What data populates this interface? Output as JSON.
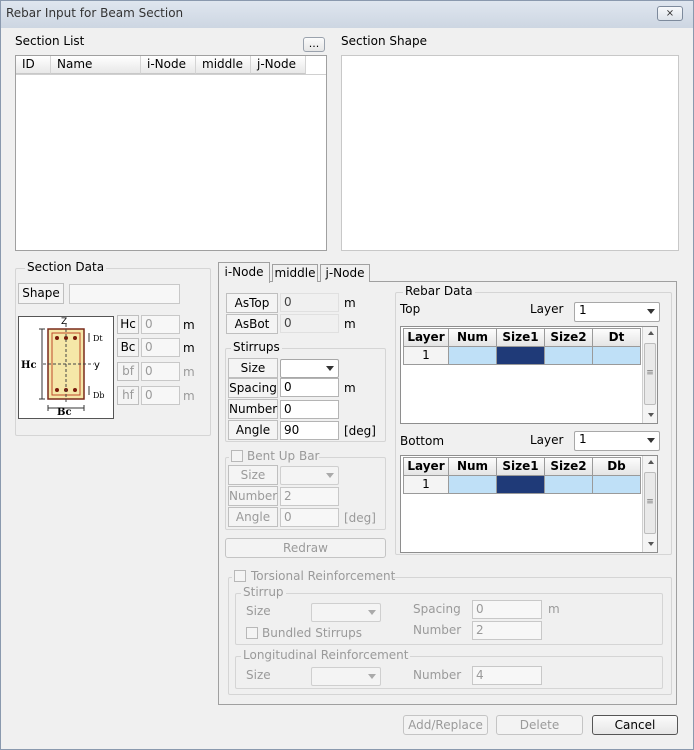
{
  "window": {
    "title": "Rebar Input for Beam Section",
    "close_glyph": "⨯"
  },
  "section_list": {
    "label": "Section List",
    "browse_label": "...",
    "columns": [
      "ID",
      "Name",
      "i-Node",
      "middle",
      "j-Node"
    ]
  },
  "section_shape": {
    "label": "Section Shape"
  },
  "section_data": {
    "label": "Section Data",
    "shape_label": "Shape",
    "shape_value": "",
    "diagram": {
      "z": "Z",
      "y": "y",
      "hc": "Hc",
      "bc": "Bc",
      "dt": "Dt",
      "db": "Db"
    },
    "hc": {
      "label": "Hc",
      "value": "0",
      "unit": "m"
    },
    "bc": {
      "label": "Bc",
      "value": "0",
      "unit": "m"
    },
    "bf": {
      "label": "bf",
      "value": "0",
      "unit": "m"
    },
    "hf": {
      "label": "hf",
      "value": "0",
      "unit": "m"
    }
  },
  "tabs": [
    "i-Node",
    "middle",
    "j-Node"
  ],
  "astop": {
    "label": "AsTop",
    "value": "0",
    "unit": "m"
  },
  "asbot": {
    "label": "AsBot",
    "value": "0",
    "unit": "m"
  },
  "stirrups": {
    "label": "Stirrups",
    "size_label": "Size",
    "size_value": "",
    "spacing_label": "Spacing",
    "spacing_value": "0",
    "spacing_unit": "m",
    "number_label": "Number",
    "number_value": "0",
    "angle_label": "Angle",
    "angle_value": "90",
    "angle_unit": "[deg]"
  },
  "bent_up_bar": {
    "label": "Bent Up Bar",
    "checked": false,
    "size_label": "Size",
    "size_value": "",
    "number_label": "Number",
    "number_value": "2",
    "angle_label": "Angle",
    "angle_value": "0",
    "angle_unit": "[deg]"
  },
  "redraw_label": "Redraw",
  "rebar_data": {
    "label": "Rebar Data",
    "top": {
      "label": "Top",
      "layer_label": "Layer",
      "layer_value": "1",
      "columns": [
        "Layer",
        "Num",
        "Size1",
        "Size2",
        "Dt"
      ],
      "rows": [
        [
          "1",
          "",
          "",
          "",
          ""
        ]
      ]
    },
    "bottom": {
      "label": "Bottom",
      "layer_label": "Layer",
      "layer_value": "1",
      "columns": [
        "Layer",
        "Num",
        "Size1",
        "Size2",
        "Db"
      ],
      "rows": [
        [
          "1",
          "",
          "",
          "",
          ""
        ]
      ]
    }
  },
  "torsional": {
    "label": "Torsional Reinforcement",
    "checked": false,
    "stirrup": {
      "label": "Stirrup",
      "size_label": "Size",
      "size_value": "",
      "spacing_label": "Spacing",
      "spacing_value": "0",
      "spacing_unit": "m",
      "bundled_label": "Bundled Stirrups",
      "number_label": "Number",
      "number_value": "2"
    },
    "longitudinal": {
      "label": "Longitudinal Reinforcement",
      "size_label": "Size",
      "size_value": "",
      "number_label": "Number",
      "number_value": "4"
    }
  },
  "buttons": {
    "add_replace": "Add/Replace",
    "delete": "Delete",
    "cancel": "Cancel"
  },
  "colors": {
    "cell_blue": "#bfe0f7",
    "selected_dark": "#1f3a78",
    "section_fill": "#f5e7a8"
  }
}
